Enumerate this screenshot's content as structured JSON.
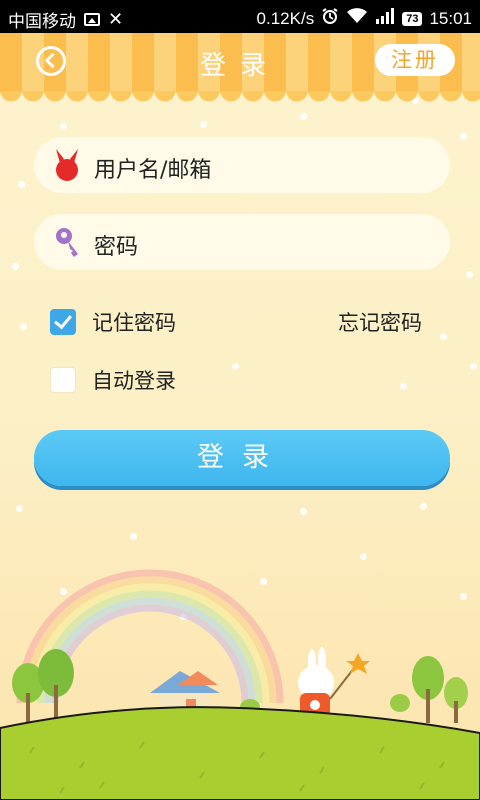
{
  "status_bar": {
    "carrier": "中国移动",
    "network_speed": "0.12K/s",
    "battery": "73",
    "time": "15:01",
    "icons": [
      "image-icon",
      "close-icon",
      "alarm-icon",
      "wifi-icon",
      "signal-icon",
      "battery-icon"
    ]
  },
  "header": {
    "title": "登录",
    "register_label": "注册"
  },
  "form": {
    "username_placeholder": "用户名/邮箱",
    "password_placeholder": "密码",
    "remember_password_label": "记住密码",
    "remember_password_checked": true,
    "forgot_password_label": "忘记密码",
    "auto_login_label": "自动登录",
    "auto_login_checked": false,
    "login_button_label": "登录"
  },
  "colors": {
    "header_orange": "#fbbe4e",
    "login_blue": "#4cbff2",
    "checkbox_blue": "#3da7e7",
    "grass_green": "#a8cf2f"
  }
}
